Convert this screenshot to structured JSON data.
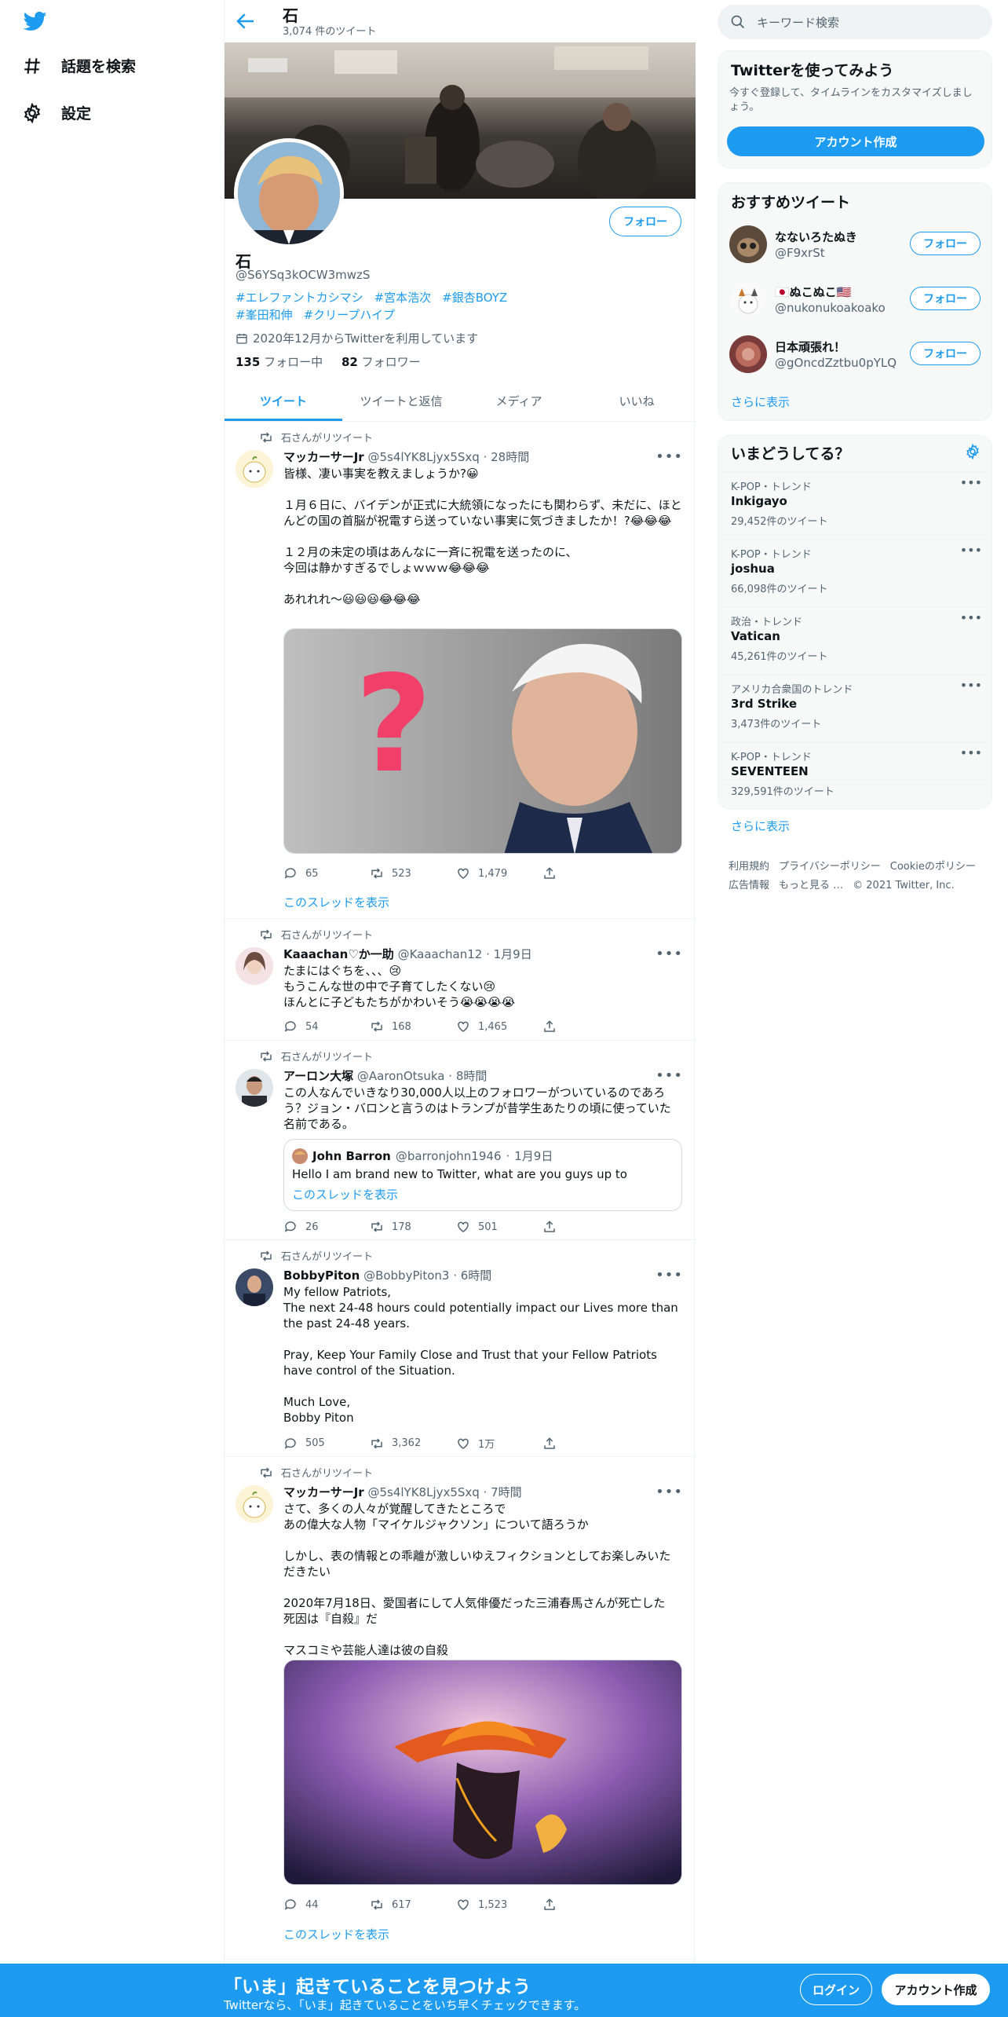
{
  "nav": {
    "explore_label": "話題を検索",
    "settings_label": "設定"
  },
  "profile": {
    "top_title": "石",
    "tweet_count": "3,074 件のツイート",
    "follow_label": "フォロー",
    "name": "石",
    "handle": "@S6YSq3kOCW3mwzS",
    "tags": [
      "#エレファントカシマシ",
      "#宮本浩次",
      "#銀杏BOYZ",
      "#峯田和伸",
      "#クリープハイプ"
    ],
    "joined": "2020年12月からTwitterを利用しています",
    "following_count": "135",
    "following_label": "フォロー中",
    "followers_count": "82",
    "followers_label": "フォロワー"
  },
  "tabs": [
    "ツイート",
    "ツイートと返信",
    "メディア",
    "いいね"
  ],
  "retweet_label": "石さんがリツイート",
  "thread_label": "このスレッドを表示",
  "tweets": [
    {
      "name": "マッカーサーJr",
      "handle": "@5s4lYK8Ljyx5Sxq",
      "time": "28時間",
      "text": "皆様、凄い事実を教えましょうか?😀\n\n１月６日に、バイデンが正式に大統領になったにも関わらず、未だに、ほとんどの国の首脳が祝電すら送っていない事実に気づきましたか！?😂😂😂\n\n１２月の未定の頃はあんなに一斉に祝電を送ったのに、\n今回は静かすぎるでしょｗｗｗ😂😂😂\n\nあれれれ～😃😃😃😂😂😂",
      "replies": "65",
      "retweets": "523",
      "likes": "1,479"
    },
    {
      "name": "Kaaachan♡か一助",
      "handle": "@Kaaachan12",
      "time": "1月9日",
      "text": "たまにはぐちを、、、😢\nもうこんな世の中で子育てしたくない😢\nほんとに子どもたちがかわいそう😭😭😭😭",
      "replies": "54",
      "retweets": "168",
      "likes": "1,465"
    },
    {
      "name": "アーロン大塚",
      "handle": "@AaronOtsuka",
      "time": "8時間",
      "text": "この人なんでいきなり30,000人以上のフォロワーがついているのであろう？ジョン・バロンと言うのはトランプが昔学生あたりの頃に使っていた名前である。",
      "quote": {
        "name": "John Barron",
        "handle": "@barronjohn1946",
        "time": "1月9日",
        "text": "Hello I am brand new to Twitter, what are you guys up to"
      },
      "replies": "26",
      "retweets": "178",
      "likes": "501"
    },
    {
      "name": "BobbyPiton",
      "handle": "@BobbyPiton3",
      "time": "6時間",
      "text": "My fellow Patriots,\nThe next 24-48 hours could potentially impact our Lives more than the past 24-48 years.\n\nPray, Keep Your Family Close and Trust that your Fellow Patriots have control of the Situation.\n\nMuch Love,\nBobby Piton",
      "replies": "505",
      "retweets": "3,362",
      "likes": "1万"
    },
    {
      "name": "マッカーサーJr",
      "handle": "@5s4lYK8Ljyx5Sxq",
      "time": "7時間",
      "text": "さて、多くの人々が覚醒してきたところで\nあの偉大な人物「マイケルジャクソン」について語ろうか\n\nしかし、表の情報との乖離が激しいゆえフィクションとしてお楽しみいただきたい\n\n2020年7月18日、愛国者にして人気俳優だった三浦春馬さんが死亡した　死因は『自殺』だ\n\nマスコミや芸能人達は彼の自殺",
      "replies": "44",
      "retweets": "617",
      "likes": "1,523"
    }
  ],
  "right": {
    "search_placeholder": "キーワード検索",
    "signup_title": "Twitterを使ってみよう",
    "signup_desc": "今すぐ登録して、タイムラインをカスタマイズしましょう。",
    "signup_button": "アカウント作成",
    "rec_title": "おすすめツイート",
    "recommendations": [
      {
        "name": "なないろたぬき",
        "handle": "@F9xrSt"
      },
      {
        "name": "🇯🇵ぬこぬこ🇺🇸",
        "handle": "@nukonukoakoako"
      },
      {
        "name": "日本頑張れ！",
        "handle": "@gOncdZztbu0pYLQ"
      }
    ],
    "show_more": "さらに表示",
    "trends_title": "いまどうしてる？",
    "trends": [
      {
        "context": "K-POP・トレンド",
        "title": "Inkigayo",
        "count": "29,452件のツイート"
      },
      {
        "context": "K-POP・トレンド",
        "title": "joshua",
        "count": "66,098件のツイート"
      },
      {
        "context": "政治・トレンド",
        "title": "Vatican",
        "count": "45,261件のツイート"
      },
      {
        "context": "アメリカ合衆国のトレンド",
        "title": "3rd Strike",
        "count": "3,473件のツイート"
      },
      {
        "context": "K-POP・トレンド",
        "title": "SEVENTEEN",
        "count": "329,591件のツイート"
      }
    ],
    "footer_links": [
      "利用規約",
      "プライバシーポリシー",
      "Cookieのポリシー",
      "広告情報",
      "もっと見る …",
      "© 2021 Twitter, Inc."
    ]
  },
  "bottombar": {
    "title": "「いま」起きていることを見つけよう",
    "subtitle": "Twitterなら、「いま」起きていることをいち早くチェックできます。",
    "login": "ログイン",
    "signup": "アカウント作成"
  },
  "colors": {
    "accent": "#1d9bf0",
    "text": "#0f1419",
    "muted": "#536471"
  }
}
